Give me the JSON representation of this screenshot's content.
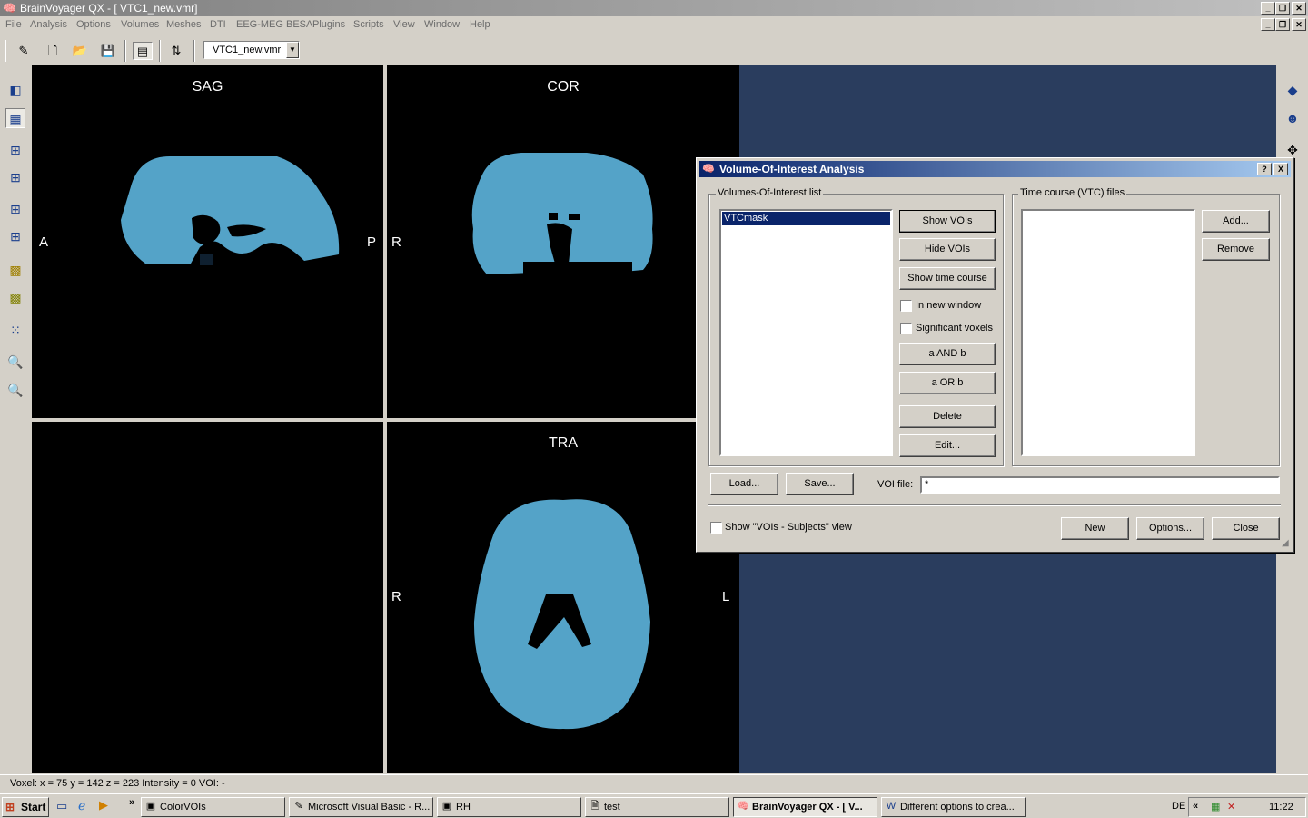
{
  "app": {
    "title": "BrainVoyager QX - [ VTC1_new.vmr]"
  },
  "menu": [
    "File",
    "Analysis",
    "Options",
    "Volumes",
    "Meshes",
    "DTI",
    "EEG-MEG BESA",
    "Plugins",
    "Scripts",
    "View",
    "Window",
    "Help"
  ],
  "toolbar": {
    "file_combo_value": "VTC1_new.vmr"
  },
  "views": {
    "sag": {
      "title": "SAG",
      "left": "A",
      "right": "P"
    },
    "cor": {
      "title": "COR",
      "left": "R"
    },
    "tra": {
      "title": "TRA",
      "left": "R",
      "right": "L"
    }
  },
  "colors": {
    "brain": "#54a3c8",
    "workspace": "#2a3d5e",
    "dialog_title": "#0a246a"
  },
  "dialog": {
    "title": "Volume-Of-Interest Analysis",
    "help_glyph": "?",
    "close_glyph": "X",
    "voi_group": "Volumes-Of-Interest list",
    "voi_items": [
      "VTCmask"
    ],
    "vtc_group": "Time course (VTC) files",
    "buttons": {
      "show_vois": "Show VOIs",
      "hide_vois": "Hide VOIs",
      "show_time_course": "Show time course",
      "a_and_b": "a AND b",
      "a_or_b": "a OR b",
      "delete": "Delete",
      "edit": "Edit...",
      "add": "Add...",
      "remove": "Remove",
      "load": "Load...",
      "save": "Save...",
      "new": "New",
      "options": "Options...",
      "close": "Close"
    },
    "checkboxes": {
      "in_new_window": "In new window",
      "significant_voxels": "Significant voxels",
      "show_subjects_view": "Show \"VOIs - Subjects\" view"
    },
    "voi_file_label": "VOI file:",
    "voi_file_value": "*"
  },
  "statusbar": {
    "text": "Voxel:  x = 75  y = 142  z = 223   Intensity = 0   VOI: -"
  },
  "taskbar": {
    "start": "Start",
    "tasks": [
      "ColorVOIs",
      "Microsoft Visual Basic - R...",
      "RH",
      "test",
      "BrainVoyager QX - [ V...",
      "Different options to crea..."
    ],
    "lang": "DE",
    "clock": "11:22"
  }
}
